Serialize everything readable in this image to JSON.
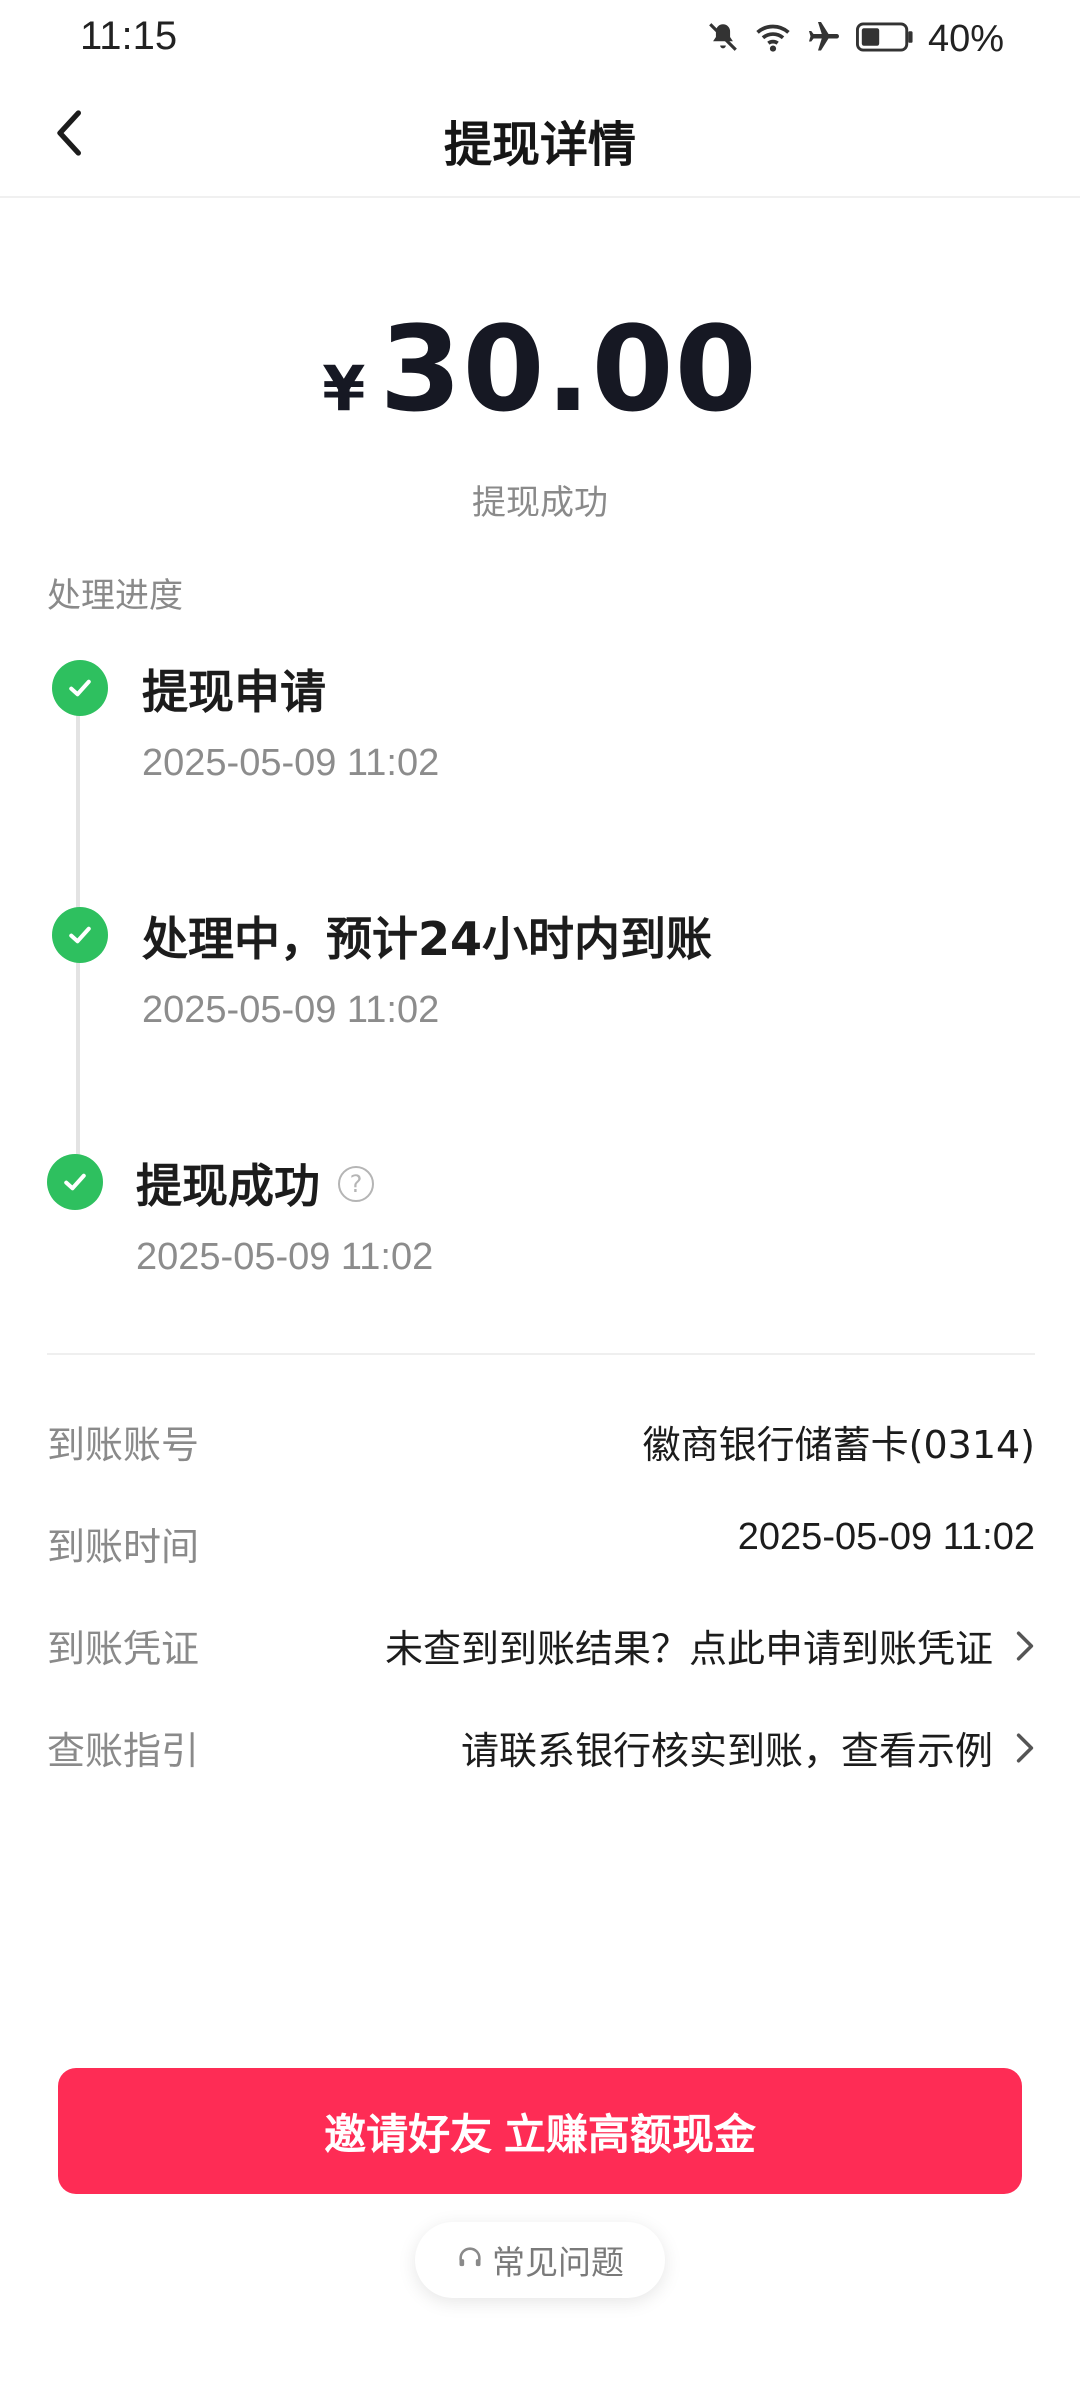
{
  "status_bar": {
    "time": "11:15",
    "battery": "40%",
    "icons": [
      "mute-bell-icon",
      "wifi-icon",
      "airplane-icon",
      "battery-icon"
    ]
  },
  "nav": {
    "title": "提现详情",
    "back_icon": "chevron-left-icon"
  },
  "amount": {
    "currency": "¥",
    "value": "30.00",
    "status": "提现成功"
  },
  "progress": {
    "label": "处理进度",
    "steps": [
      {
        "title": "提现申请",
        "time": "2025-05-09 11:02",
        "done": true
      },
      {
        "title": "处理中，预计24小时内到账",
        "time": "2025-05-09 11:02",
        "done": true
      },
      {
        "title": "提现成功",
        "time": "2025-05-09 11:02",
        "done": true,
        "help_icon": "question-circle-icon"
      }
    ]
  },
  "details": [
    {
      "label": "到账账号",
      "value": "徽商银行储蓄卡(0314)",
      "link": false
    },
    {
      "label": "到账时间",
      "value": "2025-05-09 11:02",
      "link": false
    },
    {
      "label": "到账凭证",
      "value": "未查到到账结果？点此申请到账凭证",
      "link": true
    },
    {
      "label": "查账指引",
      "value": "请联系银行核实到账，查看示例",
      "link": true
    }
  ],
  "cta": {
    "label": "邀请好友 立赚高额现金"
  },
  "faq": {
    "label": "常见问题",
    "icon": "headset-icon"
  },
  "colors": {
    "accent": "#fe2c55",
    "success": "#2ec05f",
    "secondary_text": "#8a8a8a"
  }
}
